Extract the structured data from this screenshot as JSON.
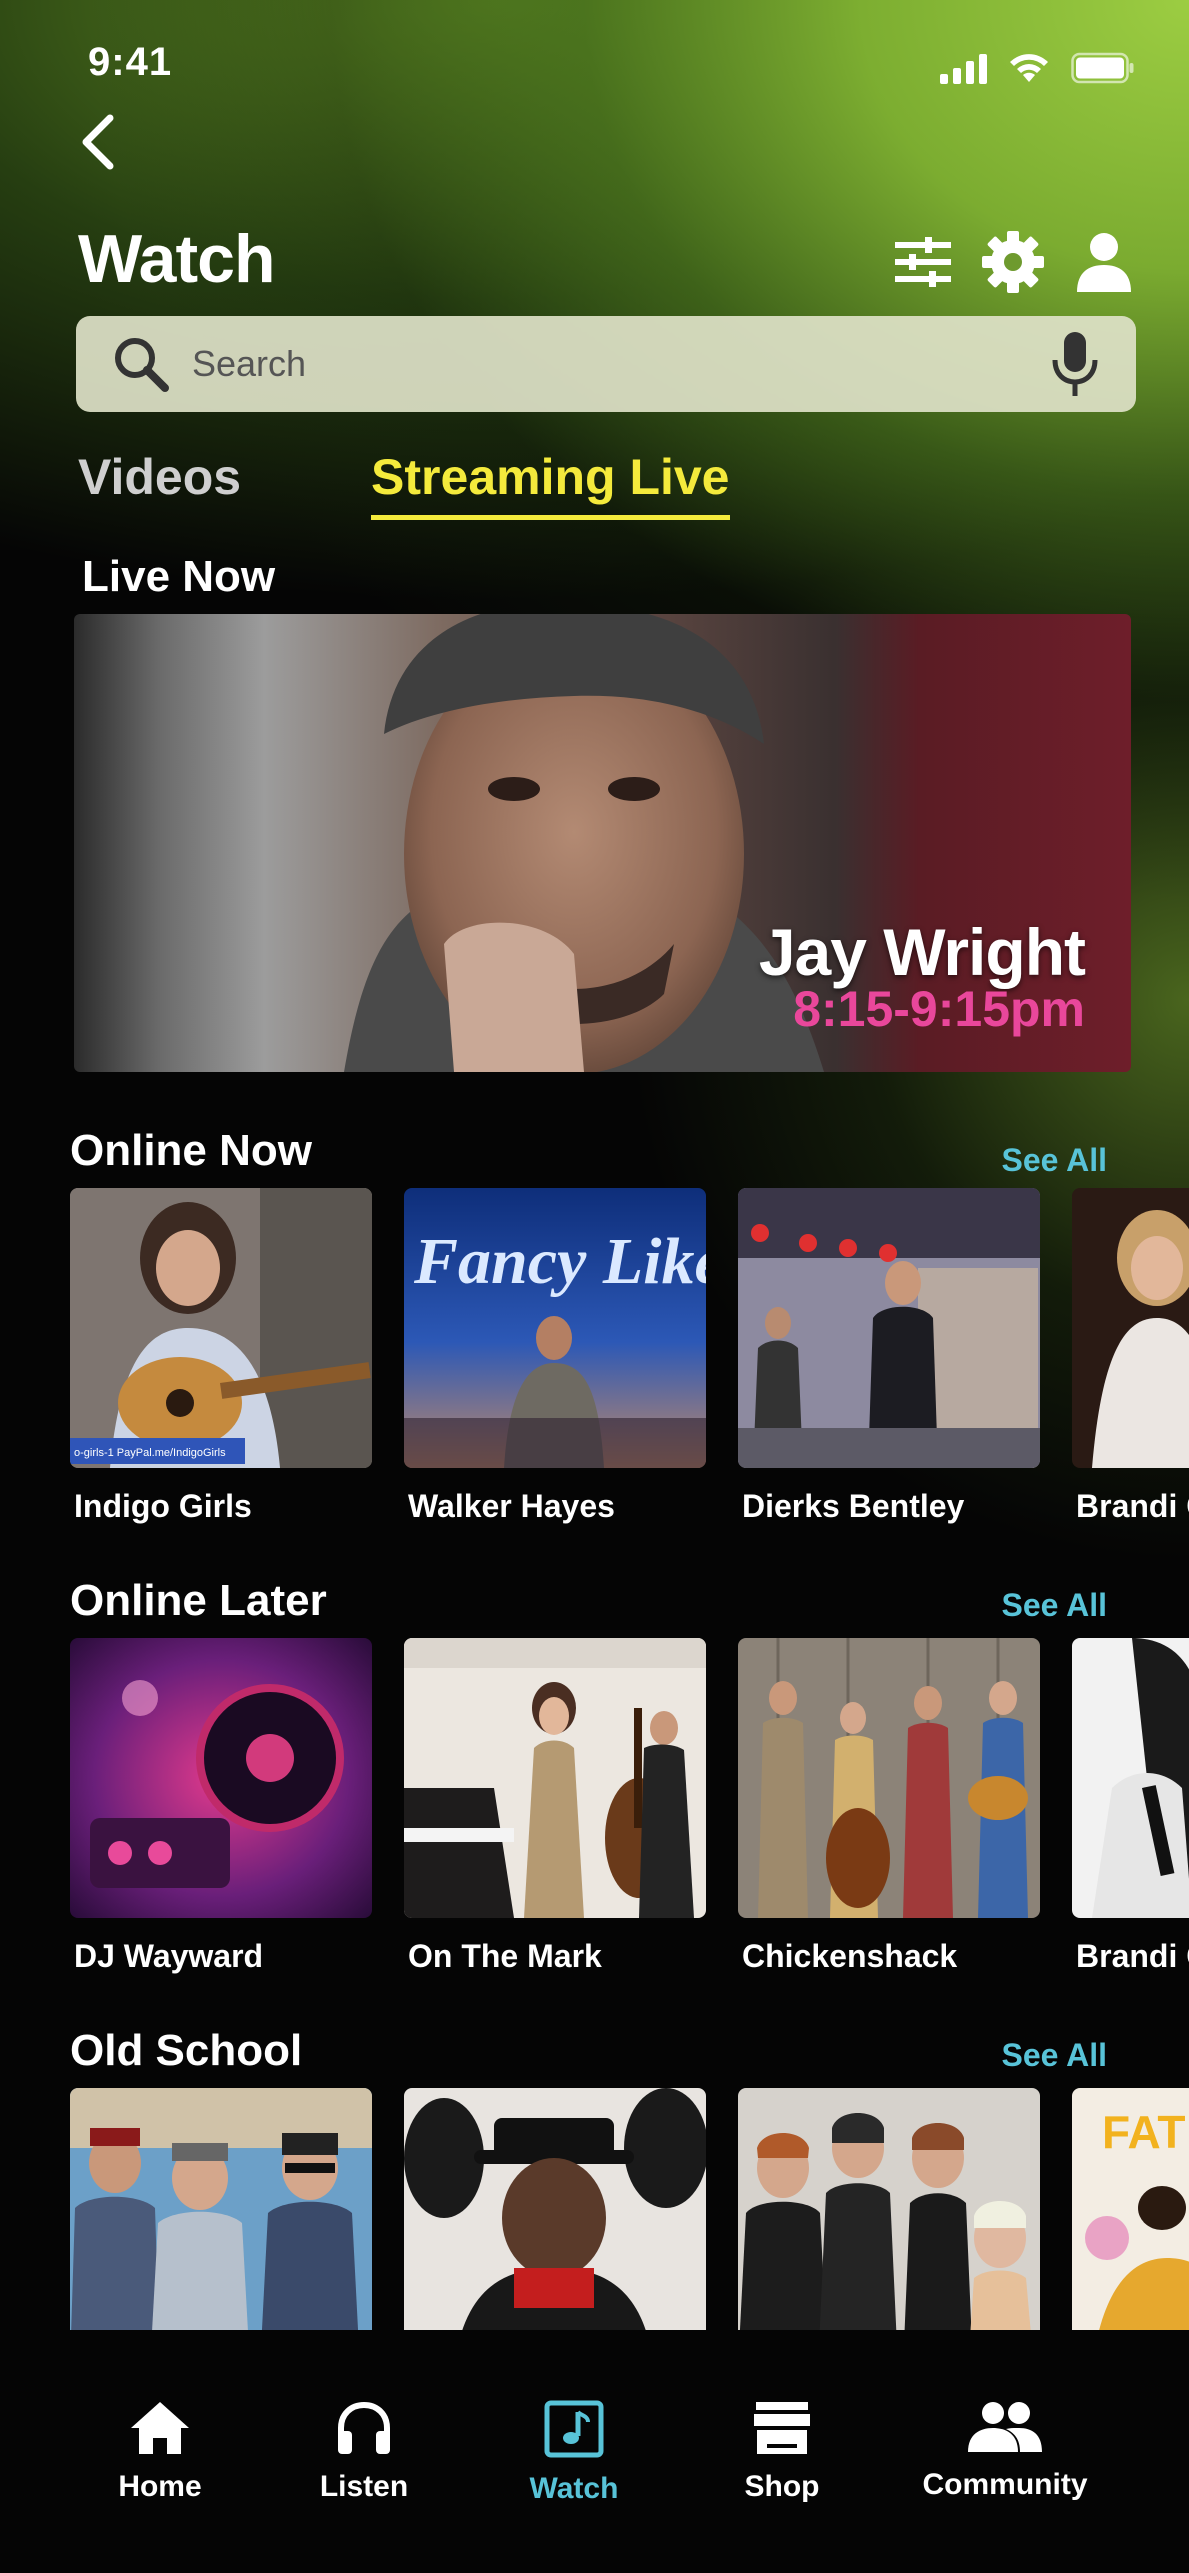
{
  "status": {
    "time": "9:41"
  },
  "header": {
    "title": "Watch"
  },
  "search": {
    "placeholder": "Search"
  },
  "tabs": [
    {
      "label": "Videos",
      "active": false
    },
    {
      "label": "Streaming Live",
      "active": true
    }
  ],
  "live_now": {
    "title": "Live Now",
    "artist": "Jay Wright",
    "time": "8:15-9:15pm"
  },
  "online_now": {
    "title": "Online Now",
    "see_all": "See All",
    "items": [
      "Indigo Girls",
      "Walker Hayes",
      "Dierks Bentley",
      "Brandi C"
    ]
  },
  "online_later": {
    "title": "Online Later",
    "see_all": "See All",
    "items": [
      "DJ Wayward",
      "On The Mark",
      "Chickenshack",
      "Brandi C"
    ]
  },
  "old_school": {
    "title": "Old School",
    "see_all": "See All",
    "items": [
      "",
      "",
      "",
      ""
    ],
    "poster_text": "FAT"
  },
  "thumb_text": {
    "fancy_like": "Fancy Like",
    "paypal": "o-girls-1 PayPal.me/IndigoGirls"
  },
  "tab_bar": [
    {
      "label": "Home",
      "icon": "home-icon",
      "active": false
    },
    {
      "label": "Listen",
      "icon": "headphones-icon",
      "active": false
    },
    {
      "label": "Watch",
      "icon": "music-note-icon",
      "active": true
    },
    {
      "label": "Shop",
      "icon": "store-icon",
      "active": false
    },
    {
      "label": "Community",
      "icon": "people-icon",
      "active": false
    }
  ],
  "colors": {
    "accent_yellow": "#f4ea3c",
    "accent_pink": "#e9479b",
    "link_blue": "#58c3d8"
  }
}
